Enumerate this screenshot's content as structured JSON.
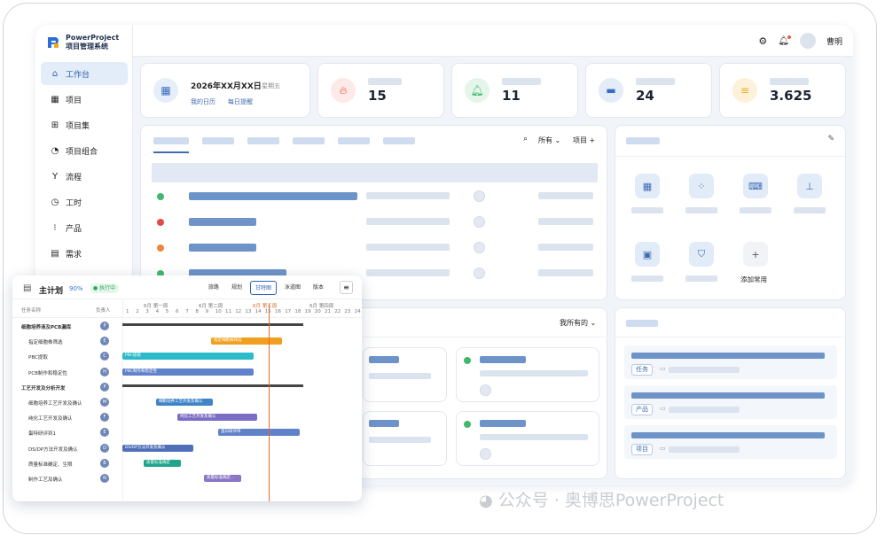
{
  "app": {
    "brand_en": "PowerProject",
    "brand_cn": "项目管理系统"
  },
  "topbar": {
    "user_name": "曹明"
  },
  "sidebar": {
    "items": [
      {
        "label": "工作台",
        "icon": "home-icon",
        "active": true
      },
      {
        "label": "项目",
        "icon": "project-icon"
      },
      {
        "label": "项目集",
        "icon": "program-icon"
      },
      {
        "label": "项目组合",
        "icon": "portfolio-icon"
      },
      {
        "label": "流程",
        "icon": "flow-icon"
      },
      {
        "label": "工时",
        "icon": "clock-icon"
      },
      {
        "label": "产品",
        "icon": "product-icon"
      },
      {
        "label": "需求",
        "icon": "requirement-icon"
      }
    ]
  },
  "date_card": {
    "date": "2026年XX月XX日",
    "weekday": "星期五",
    "link1": "我的日历",
    "link2": "每日提醒"
  },
  "stats": [
    {
      "value": "15",
      "icon": "fire-icon",
      "color": "#f25a4a"
    },
    {
      "value": "11",
      "icon": "bell-icon",
      "color": "#3fb86a"
    },
    {
      "value": "24",
      "icon": "briefcase-icon",
      "color": "#3a6cc0"
    },
    {
      "value": "3.625",
      "icon": "coins-icon",
      "color": "#f0a81e"
    }
  ],
  "work_panel": {
    "filter_label": "所有",
    "project_label": "项目"
  },
  "quick_access": {
    "add_label": "添加常用"
  },
  "mine_panel": {
    "filter_label": "我所有的"
  },
  "right_list": {
    "tags": [
      "任务",
      "产品",
      "项目"
    ]
  },
  "gantt": {
    "title": "主计划",
    "percent": "90%",
    "status": "执行中",
    "tabs": [
      "旅路",
      "规划",
      "甘特图",
      "泳道图",
      "版本"
    ],
    "active_tab": "甘特图",
    "col_task": "任务名称",
    "col_owner": "负责人",
    "weeks": [
      "6月 第一周",
      "6月 第二周",
      "6月 第三周",
      "6月 第四周"
    ],
    "days": [
      "1",
      "2",
      "3",
      "4",
      "5",
      "6",
      "7",
      "8",
      "9",
      "10",
      "11",
      "12",
      "13",
      "14",
      "15",
      "16",
      "17",
      "18",
      "19",
      "20",
      "21",
      "22",
      "23",
      "24"
    ],
    "rows": [
      {
        "name": "细胞培养液及PCB漏库",
        "indent": 0,
        "avatar": "P"
      },
      {
        "name": "指定细胞株筛选",
        "indent": 1,
        "avatar": "E",
        "bar": "指定细胞株筛选"
      },
      {
        "name": "PBC提取",
        "indent": 1,
        "avatar": "C",
        "bar": "PBC提取"
      },
      {
        "name": "PCB制作和稳定性",
        "indent": 1,
        "avatar": "H",
        "bar": "PBC制作和稳定性"
      },
      {
        "name": "工艺开发及分析开发",
        "indent": 0,
        "avatar": "P"
      },
      {
        "name": "细胞培养工艺开发及确认",
        "indent": 1,
        "avatar": "M",
        "bar": "细胞培养工艺开发及确认"
      },
      {
        "name": "纯化工艺开发及确认",
        "indent": 1,
        "avatar": "F",
        "bar": "纯化工艺开发及确认"
      },
      {
        "name": "蛋特研评到1",
        "indent": 1,
        "avatar": "E",
        "bar": "蛋白研评审"
      },
      {
        "name": "DS/DP方法开发及确认",
        "indent": 1,
        "avatar": "D",
        "bar": "DS/DP方法开发及确认"
      },
      {
        "name": "质量标准确定、生限",
        "indent": 1,
        "avatar": "B",
        "bar": "质量标准确定"
      },
      {
        "name": "制作工艺及确认",
        "indent": 1,
        "avatar": "N",
        "bar": "质量标准确定..."
      }
    ]
  },
  "watermark": "公众号 · 奥博思PowerProject"
}
